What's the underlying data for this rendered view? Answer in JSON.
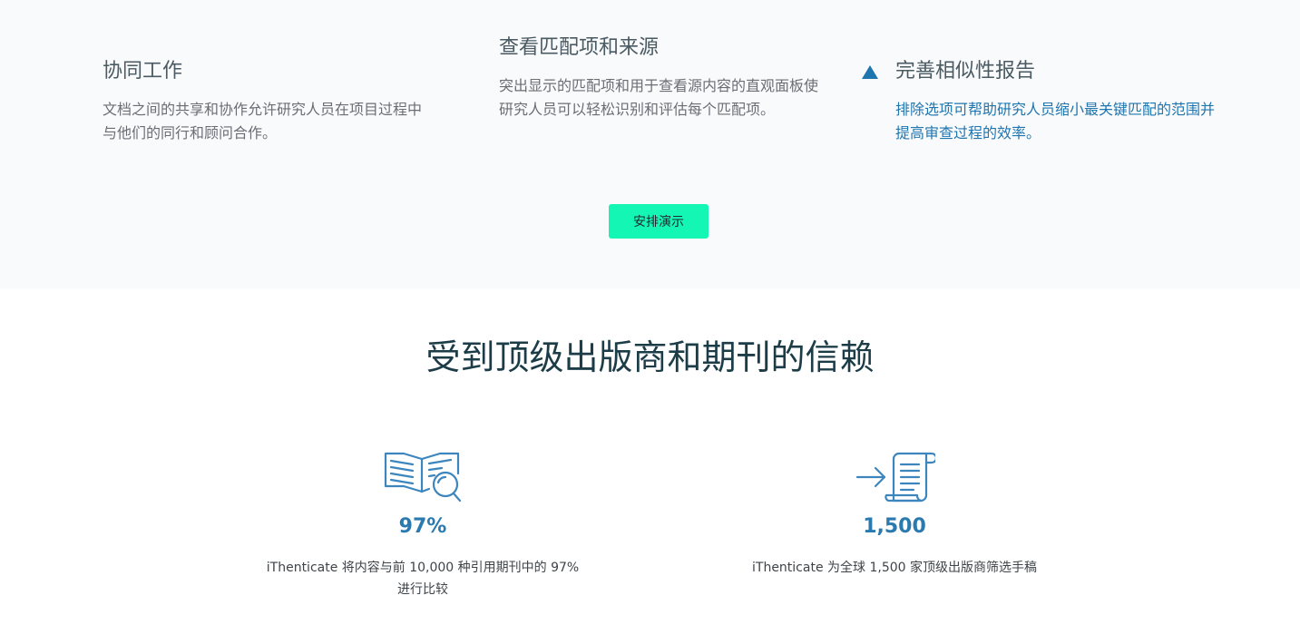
{
  "features": [
    {
      "title": "协同工作",
      "description": "文档之间的共享和协作允许研究人员在项目过程中与他们的同行和顾问合作。"
    },
    {
      "title": "查看匹配项和来源",
      "description": "突出显示的匹配项和用于查看源内容的直观面板使研究人员可以轻松识别和评估每个匹配项。"
    },
    {
      "title": "完善相似性报告",
      "description": "排除选项可帮助研究人员缩小最关键匹配的范围并提高审查过程的效率。",
      "icon": "triangle-up-icon",
      "accent_color": "#1f75ae"
    }
  ],
  "demo_button": {
    "label": "安排演示",
    "color": "#14f7b4"
  },
  "trust": {
    "title": "受到顶级出版商和期刊的信赖",
    "stats": [
      {
        "icon": "book-magnifier-icon",
        "value": "97%",
        "description": "iThenticate 将内容与前 10,000 种引用期刊中的 97% 进行比较"
      },
      {
        "icon": "arrow-scroll-icon",
        "value": "1,500",
        "description": "iThenticate 为全球 1,500 家顶级出版商筛选手稿"
      }
    ]
  }
}
